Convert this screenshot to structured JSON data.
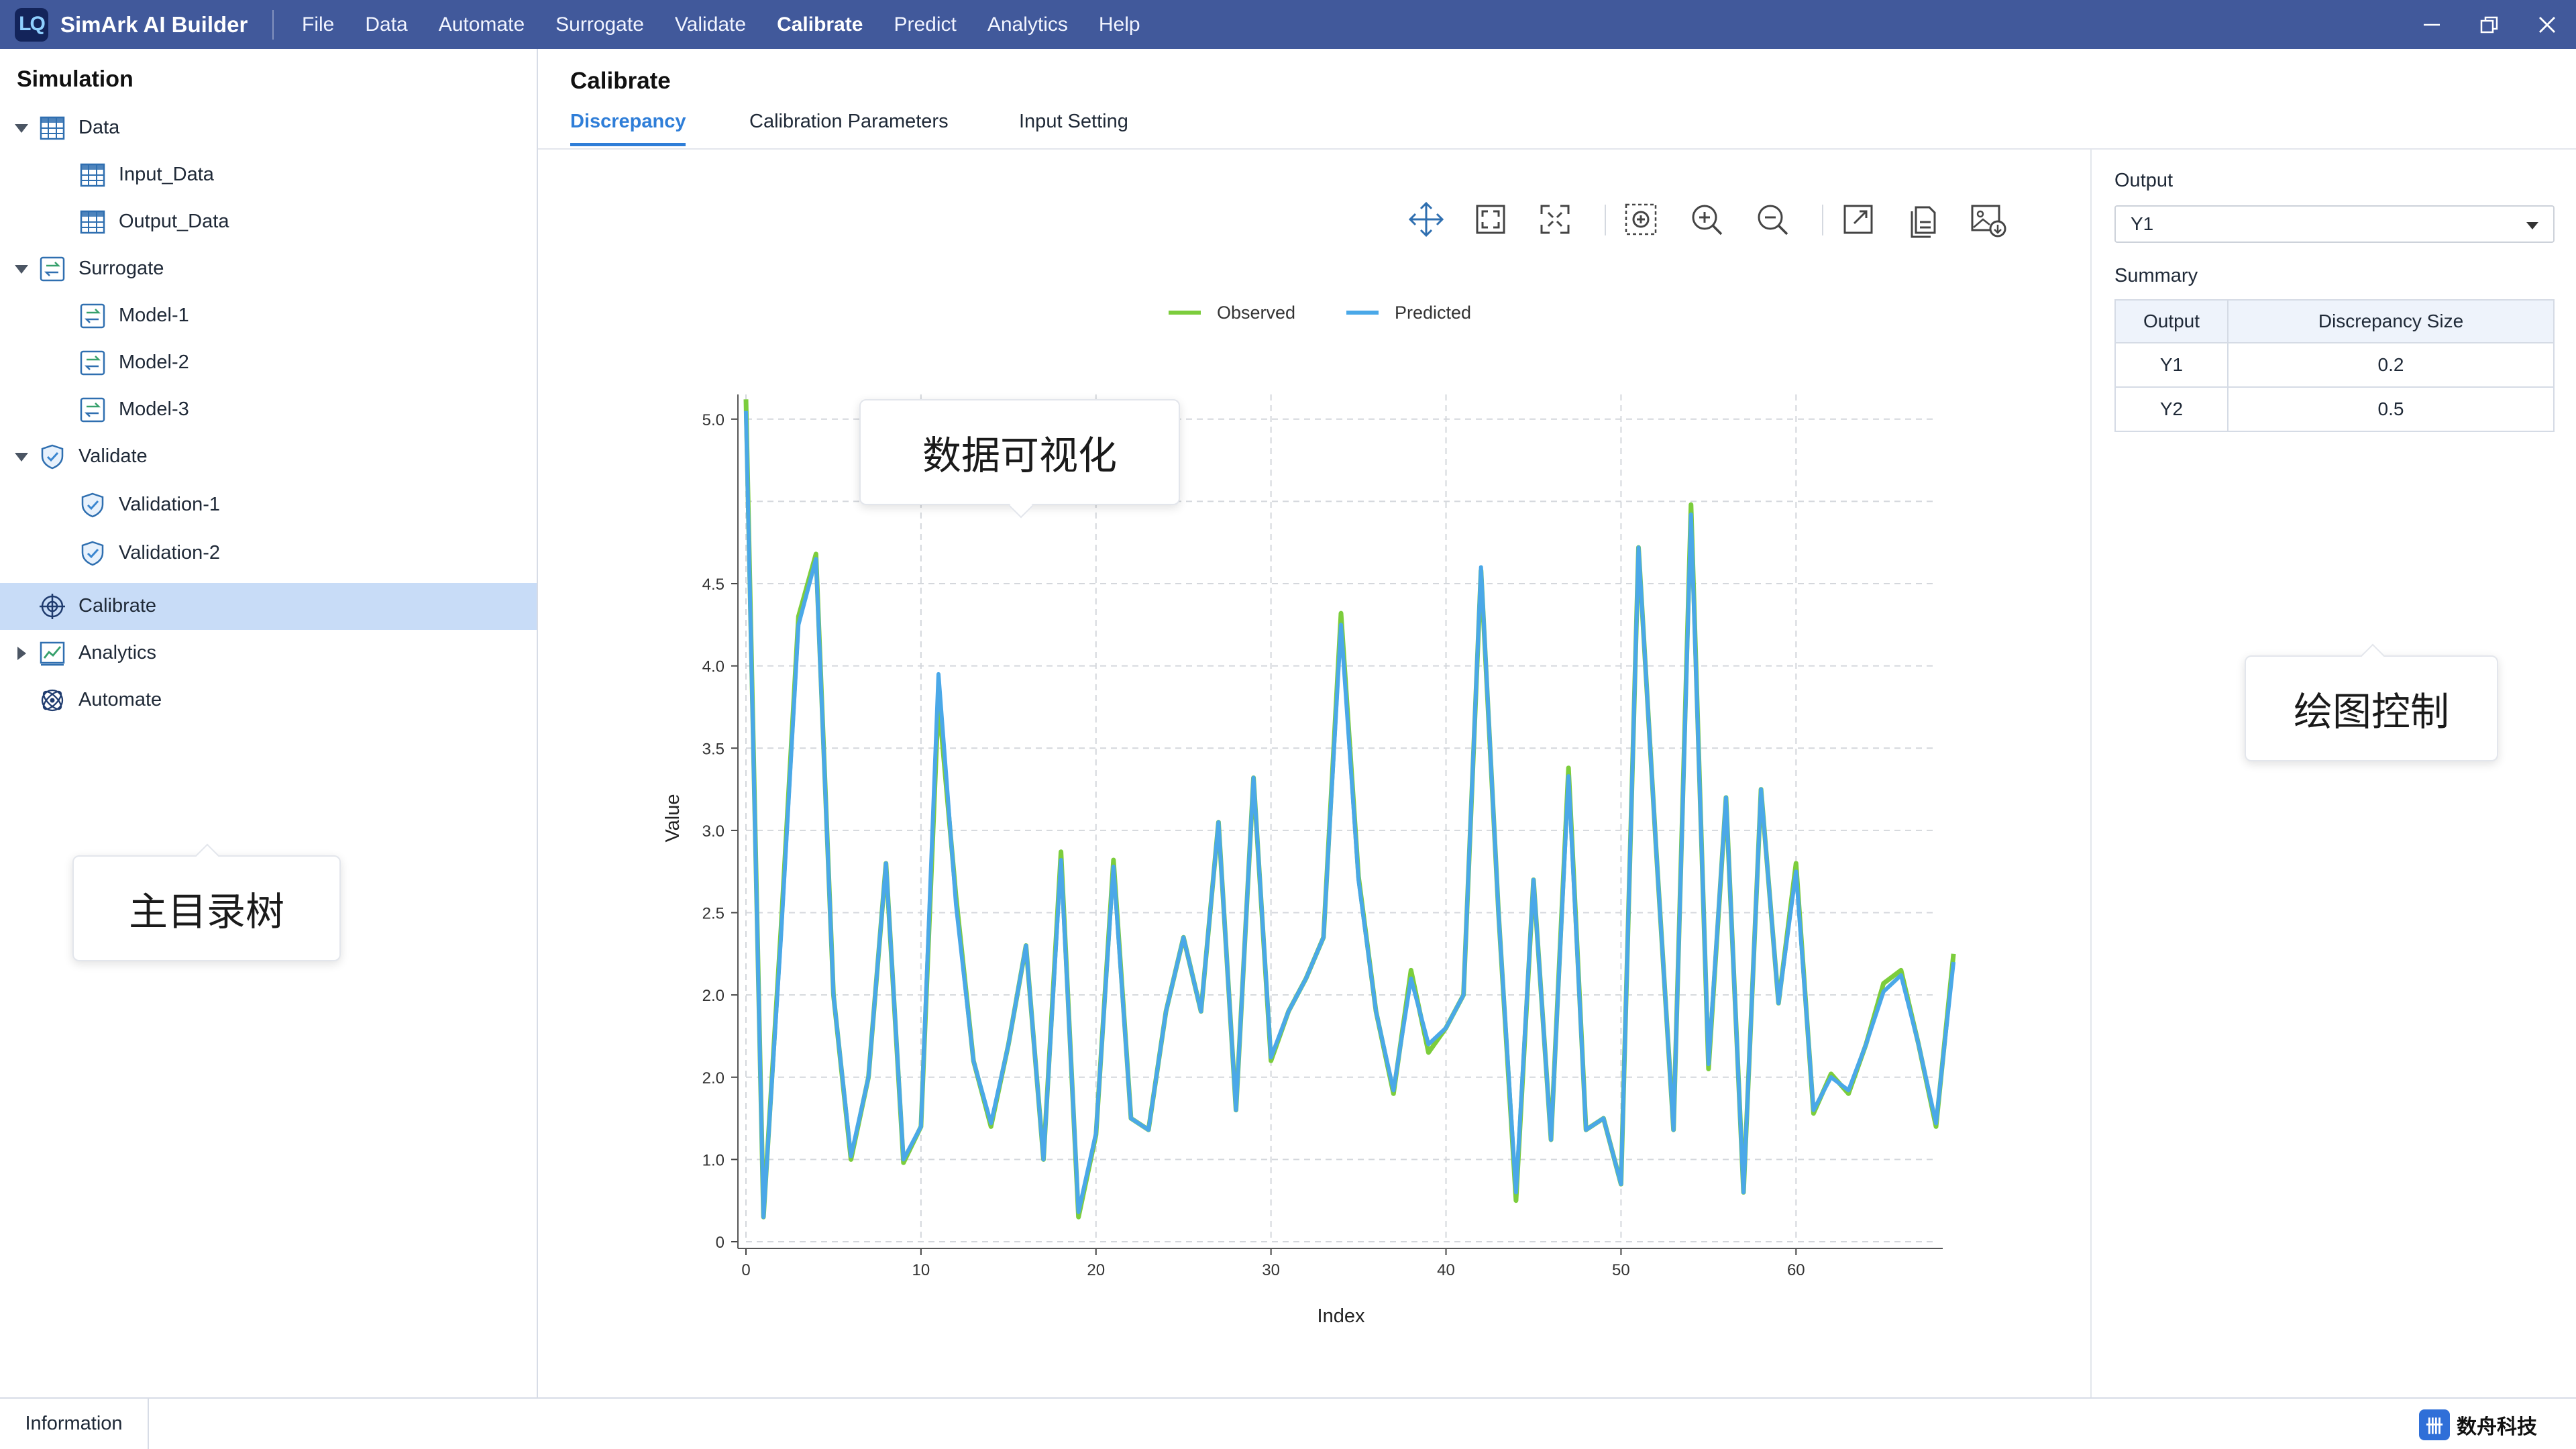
{
  "app": {
    "title": "SimArk AI Builder",
    "logo_text": "LQ"
  },
  "menu": [
    "File",
    "Data",
    "Automate",
    "Surrogate",
    "Validate",
    "Calibrate",
    "Predict",
    "Analytics",
    "Help"
  ],
  "menu_active": "Calibrate",
  "sidebar": {
    "title": "Simulation",
    "items": [
      {
        "label": "Data",
        "icon": "table-icon",
        "level": 0,
        "expanded": true
      },
      {
        "label": "Input_Data",
        "icon": "table-icon",
        "level": 1
      },
      {
        "label": "Output_Data",
        "icon": "table-icon",
        "level": 1
      },
      {
        "label": "Surrogate",
        "icon": "surrogate-icon",
        "level": 0,
        "expanded": true
      },
      {
        "label": "Model-1",
        "icon": "surrogate-icon",
        "level": 1
      },
      {
        "label": "Model-2",
        "icon": "surrogate-icon",
        "level": 1
      },
      {
        "label": "Model-3",
        "icon": "surrogate-icon",
        "level": 1
      },
      {
        "label": "Validate",
        "icon": "shield-check-icon",
        "level": 0,
        "expanded": true
      },
      {
        "label": "Validation-1",
        "icon": "shield-check-icon",
        "level": 1
      },
      {
        "label": "Validation-2",
        "icon": "shield-check-icon",
        "level": 1
      },
      {
        "label": "Calibrate",
        "icon": "crosshair-icon",
        "level": 0,
        "selected": true
      },
      {
        "label": "Analytics",
        "icon": "line-chart-icon",
        "level": 0,
        "expanded": false
      },
      {
        "label": "Automate",
        "icon": "atom-icon",
        "level": 0
      }
    ]
  },
  "main": {
    "title": "Calibrate",
    "tabs": [
      "Discrepancy",
      "Calibration Parameters",
      "Input Setting"
    ],
    "active_tab": "Discrepancy"
  },
  "toolbar_icons": [
    "pan-icon",
    "zoom-extent-icon",
    "zoom-fit-icon",
    "zoom-box-icon",
    "zoom-in-icon",
    "zoom-out-icon",
    "export-icon",
    "copy-icon",
    "save-image-icon"
  ],
  "right_panel": {
    "output_label": "Output",
    "output_value": "Y1",
    "summary_label": "Summary",
    "table_headers": [
      "Output",
      "Discrepancy Size"
    ],
    "table_rows": [
      [
        "Y1",
        "0.2"
      ],
      [
        "Y2",
        "0.5"
      ]
    ]
  },
  "callouts": {
    "visualization": "数据可视化",
    "plot_control": "绘图控制",
    "main_tree": "主目录树"
  },
  "statusbar": {
    "tab": "Information",
    "brand_mark": "卌",
    "brand_text": "数舟科技"
  },
  "colors": {
    "titlebar": "#41599b",
    "observed": "#7ccd3c",
    "predicted": "#4aa8e8",
    "accent": "#2f7ed8",
    "selected_row": "#c8dcf7"
  },
  "chart_data": {
    "type": "line",
    "title": "",
    "xlabel": "Index",
    "ylabel": "Value",
    "xlim": [
      0,
      68
    ],
    "ylim": [
      0,
      5.15
    ],
    "x_ticks": [
      0,
      10,
      20,
      30,
      40,
      50,
      60
    ],
    "y_ticks": [
      0,
      0.5,
      1.0,
      1.5,
      2.0,
      2.5,
      3.0,
      3.5,
      4.0,
      4.5,
      5.0
    ],
    "y_tick_labels": [
      "0",
      "1.0",
      "2.0",
      "2.0",
      "2.5",
      "3.0",
      "3.5",
      "4.0",
      "4.5",
      "5.0"
    ],
    "y_tick_label_values": [
      0,
      0.5,
      1.0,
      1.5,
      2.0,
      2.5,
      3.0,
      3.5,
      4.0,
      5.0
    ],
    "y_tick_labels_all": [
      "0",
      "1.0",
      "2.0",
      "2.0",
      "2.5",
      "3.0",
      "3.5",
      "4.0",
      "4.5",
      "5.0"
    ],
    "grid": true,
    "legend_position": "top",
    "series": [
      {
        "name": "Observed",
        "color": "#7ccd3c",
        "values": [
          5.12,
          0.15,
          1.9,
          3.8,
          4.18,
          1.5,
          0.5,
          1.0,
          2.3,
          0.48,
          0.7,
          3.3,
          2.1,
          1.1,
          0.7,
          1.2,
          1.8,
          0.5,
          2.37,
          0.15,
          0.65,
          2.32,
          0.75,
          0.68,
          1.4,
          1.85,
          1.4,
          2.55,
          0.8,
          2.82,
          1.1,
          1.4,
          1.6,
          1.85,
          3.82,
          2.22,
          1.4,
          0.9,
          1.65,
          1.15,
          1.3,
          1.5,
          4.08,
          2.0,
          0.25,
          2.2,
          0.62,
          2.88,
          0.68,
          0.75,
          0.35,
          4.22,
          2.4,
          0.68,
          4.48,
          1.05,
          2.7,
          0.3,
          2.75,
          1.45,
          2.3,
          0.78,
          1.02,
          0.9,
          1.2,
          1.57,
          1.65,
          1.2,
          0.7,
          1.75
        ]
      },
      {
        "name": "Predicted",
        "color": "#4aa8e8",
        "values": [
          5.05,
          0.15,
          1.85,
          3.75,
          4.15,
          1.5,
          0.52,
          1.0,
          2.3,
          0.5,
          0.7,
          3.45,
          2.05,
          1.1,
          0.72,
          1.2,
          1.8,
          0.5,
          2.32,
          0.18,
          0.66,
          2.28,
          0.75,
          0.68,
          1.4,
          1.85,
          1.4,
          2.55,
          0.8,
          2.82,
          1.12,
          1.4,
          1.6,
          1.85,
          3.75,
          2.2,
          1.4,
          0.92,
          1.6,
          1.2,
          1.3,
          1.5,
          4.1,
          2.0,
          0.3,
          2.2,
          0.62,
          2.83,
          0.68,
          0.75,
          0.35,
          4.22,
          2.4,
          0.68,
          4.42,
          1.08,
          2.7,
          0.3,
          2.75,
          1.45,
          2.25,
          0.8,
          1.0,
          0.92,
          1.2,
          1.52,
          1.62,
          1.2,
          0.72,
          1.7
        ]
      }
    ]
  }
}
